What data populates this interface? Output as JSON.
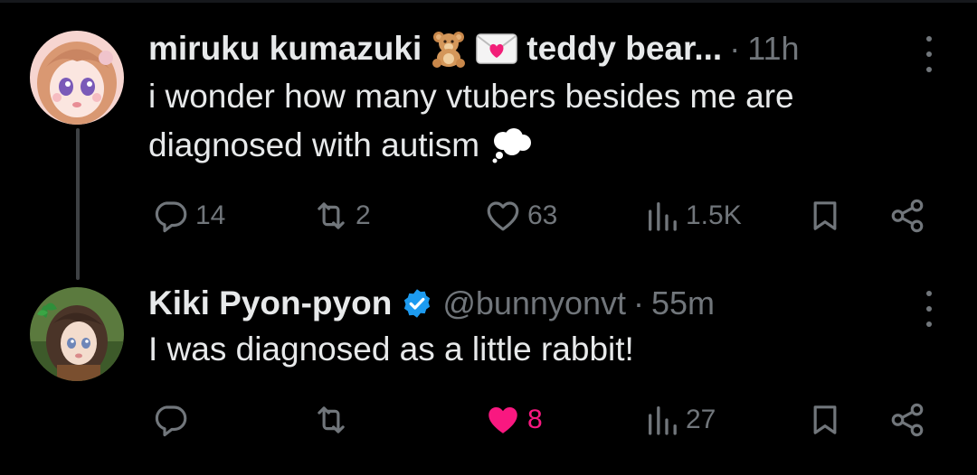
{
  "tweets": [
    {
      "name": "miruku kumazuki",
      "emoji": [
        "teddy-bear",
        "love-letter"
      ],
      "name_suffix": "teddy bear...",
      "dot": "·",
      "time": "11h",
      "text_line1": "i wonder how many vtubers besides me are",
      "text_line2": "diagnosed with autism",
      "text_emoji": "thought-balloon",
      "replies": "14",
      "reposts": "2",
      "likes": "63",
      "views": "1.5K",
      "liked": false
    },
    {
      "name": "Kiki Pyon-pyon",
      "handle": "@bunnyonvt",
      "dot": "·",
      "time": "55m",
      "text": "I was diagnosed as a little rabbit!",
      "replies": "",
      "reposts": "",
      "likes": "8",
      "views": "27",
      "liked": true
    }
  ],
  "colors": {
    "background": "#000000",
    "text": "#e7e9ea",
    "secondary": "#71767b",
    "verified": "#1d9bf0",
    "like": "#f91880",
    "thread_line": "#3e4144"
  }
}
